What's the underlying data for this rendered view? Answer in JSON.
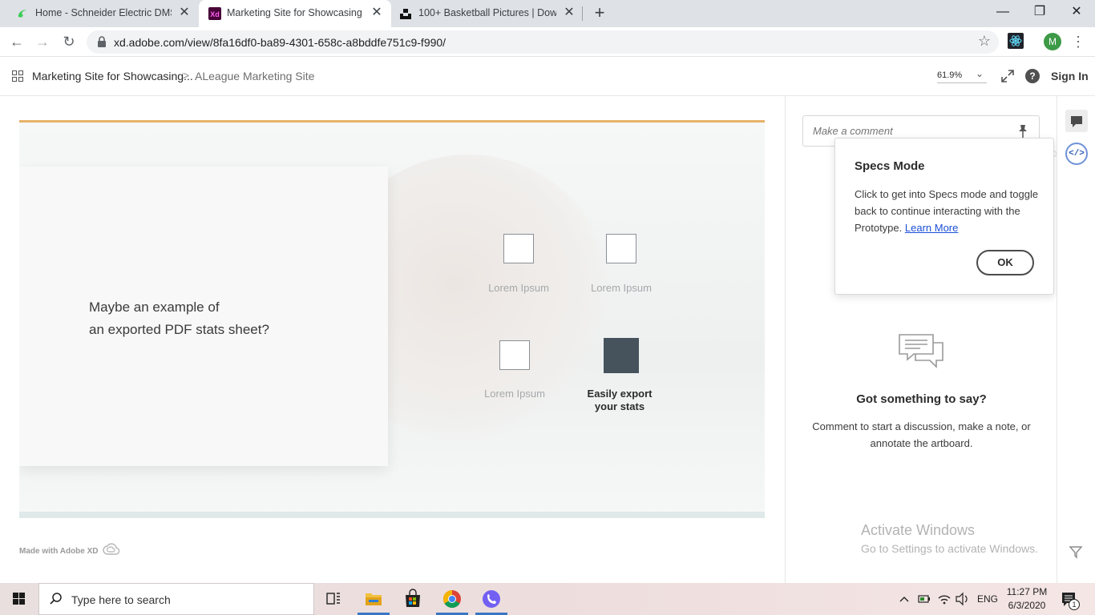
{
  "browser": {
    "tabs": [
      {
        "title": "Home - Schneider Electric DMS",
        "close": "✕",
        "active": false
      },
      {
        "title": "Marketing Site for Showcasing th",
        "close": "✕",
        "active": true
      },
      {
        "title": "100+ Basketball Pictures | Downl",
        "close": "✕",
        "active": false
      }
    ],
    "new_tab": "+",
    "window_controls": {
      "minimize": "—",
      "maximize": "❐",
      "close": "✕"
    },
    "url": "xd.adobe.com/view/8fa16df0-ba89-4301-658c-a8bddfe751c9-f990/",
    "profile_initial": "M",
    "nav": {
      "back": "←",
      "forward": "→",
      "reload": "↻",
      "bookmark": "☆",
      "menu": "⋮"
    }
  },
  "xd_header": {
    "breadcrumb_project": "Marketing Site for Showcasing...",
    "breadcrumb_sep": ">",
    "breadcrumb_artboard": "ALeague Marketing Site",
    "zoom": "61.9%",
    "zoom_chevron": "⌄",
    "help": "?",
    "sign_in": "Sign In"
  },
  "artboard": {
    "card_line1": "Maybe an example of",
    "card_line2": "an exported PDF stats sheet?",
    "features": [
      {
        "label": "Lorem Ipsum"
      },
      {
        "label": "Lorem Ipsum"
      },
      {
        "label": "Lorem Ipsum"
      },
      {
        "label_line1": "Easily export",
        "label_line2": "your stats"
      }
    ]
  },
  "canvas_footer": {
    "made_with": "Made with Adobe XD"
  },
  "comments": {
    "input_placeholder": "Make a comment",
    "empty_title": "Got something to say?",
    "empty_body": "Comment to start a discussion, make a note, or annotate the artboard."
  },
  "specs_popup": {
    "title": "Specs Mode",
    "body": "Click to get into Specs mode and toggle back to continue interacting with the Prototype.",
    "link": "Learn More",
    "ok": "OK"
  },
  "rail": {
    "code_label": "</>"
  },
  "watermark": {
    "line1": "Activate Windows",
    "line2": "Go to Settings to activate Windows."
  },
  "taskbar": {
    "search_placeholder": "Type here to search",
    "lang": "ENG",
    "time": "11:27 PM",
    "date": "6/3/2020",
    "notification_count": "1"
  },
  "colors": {
    "artboard_top_border": "#e6b267",
    "filled_box": "#46535d",
    "link": "#1a4fd6",
    "profile": "#3d9a47"
  }
}
